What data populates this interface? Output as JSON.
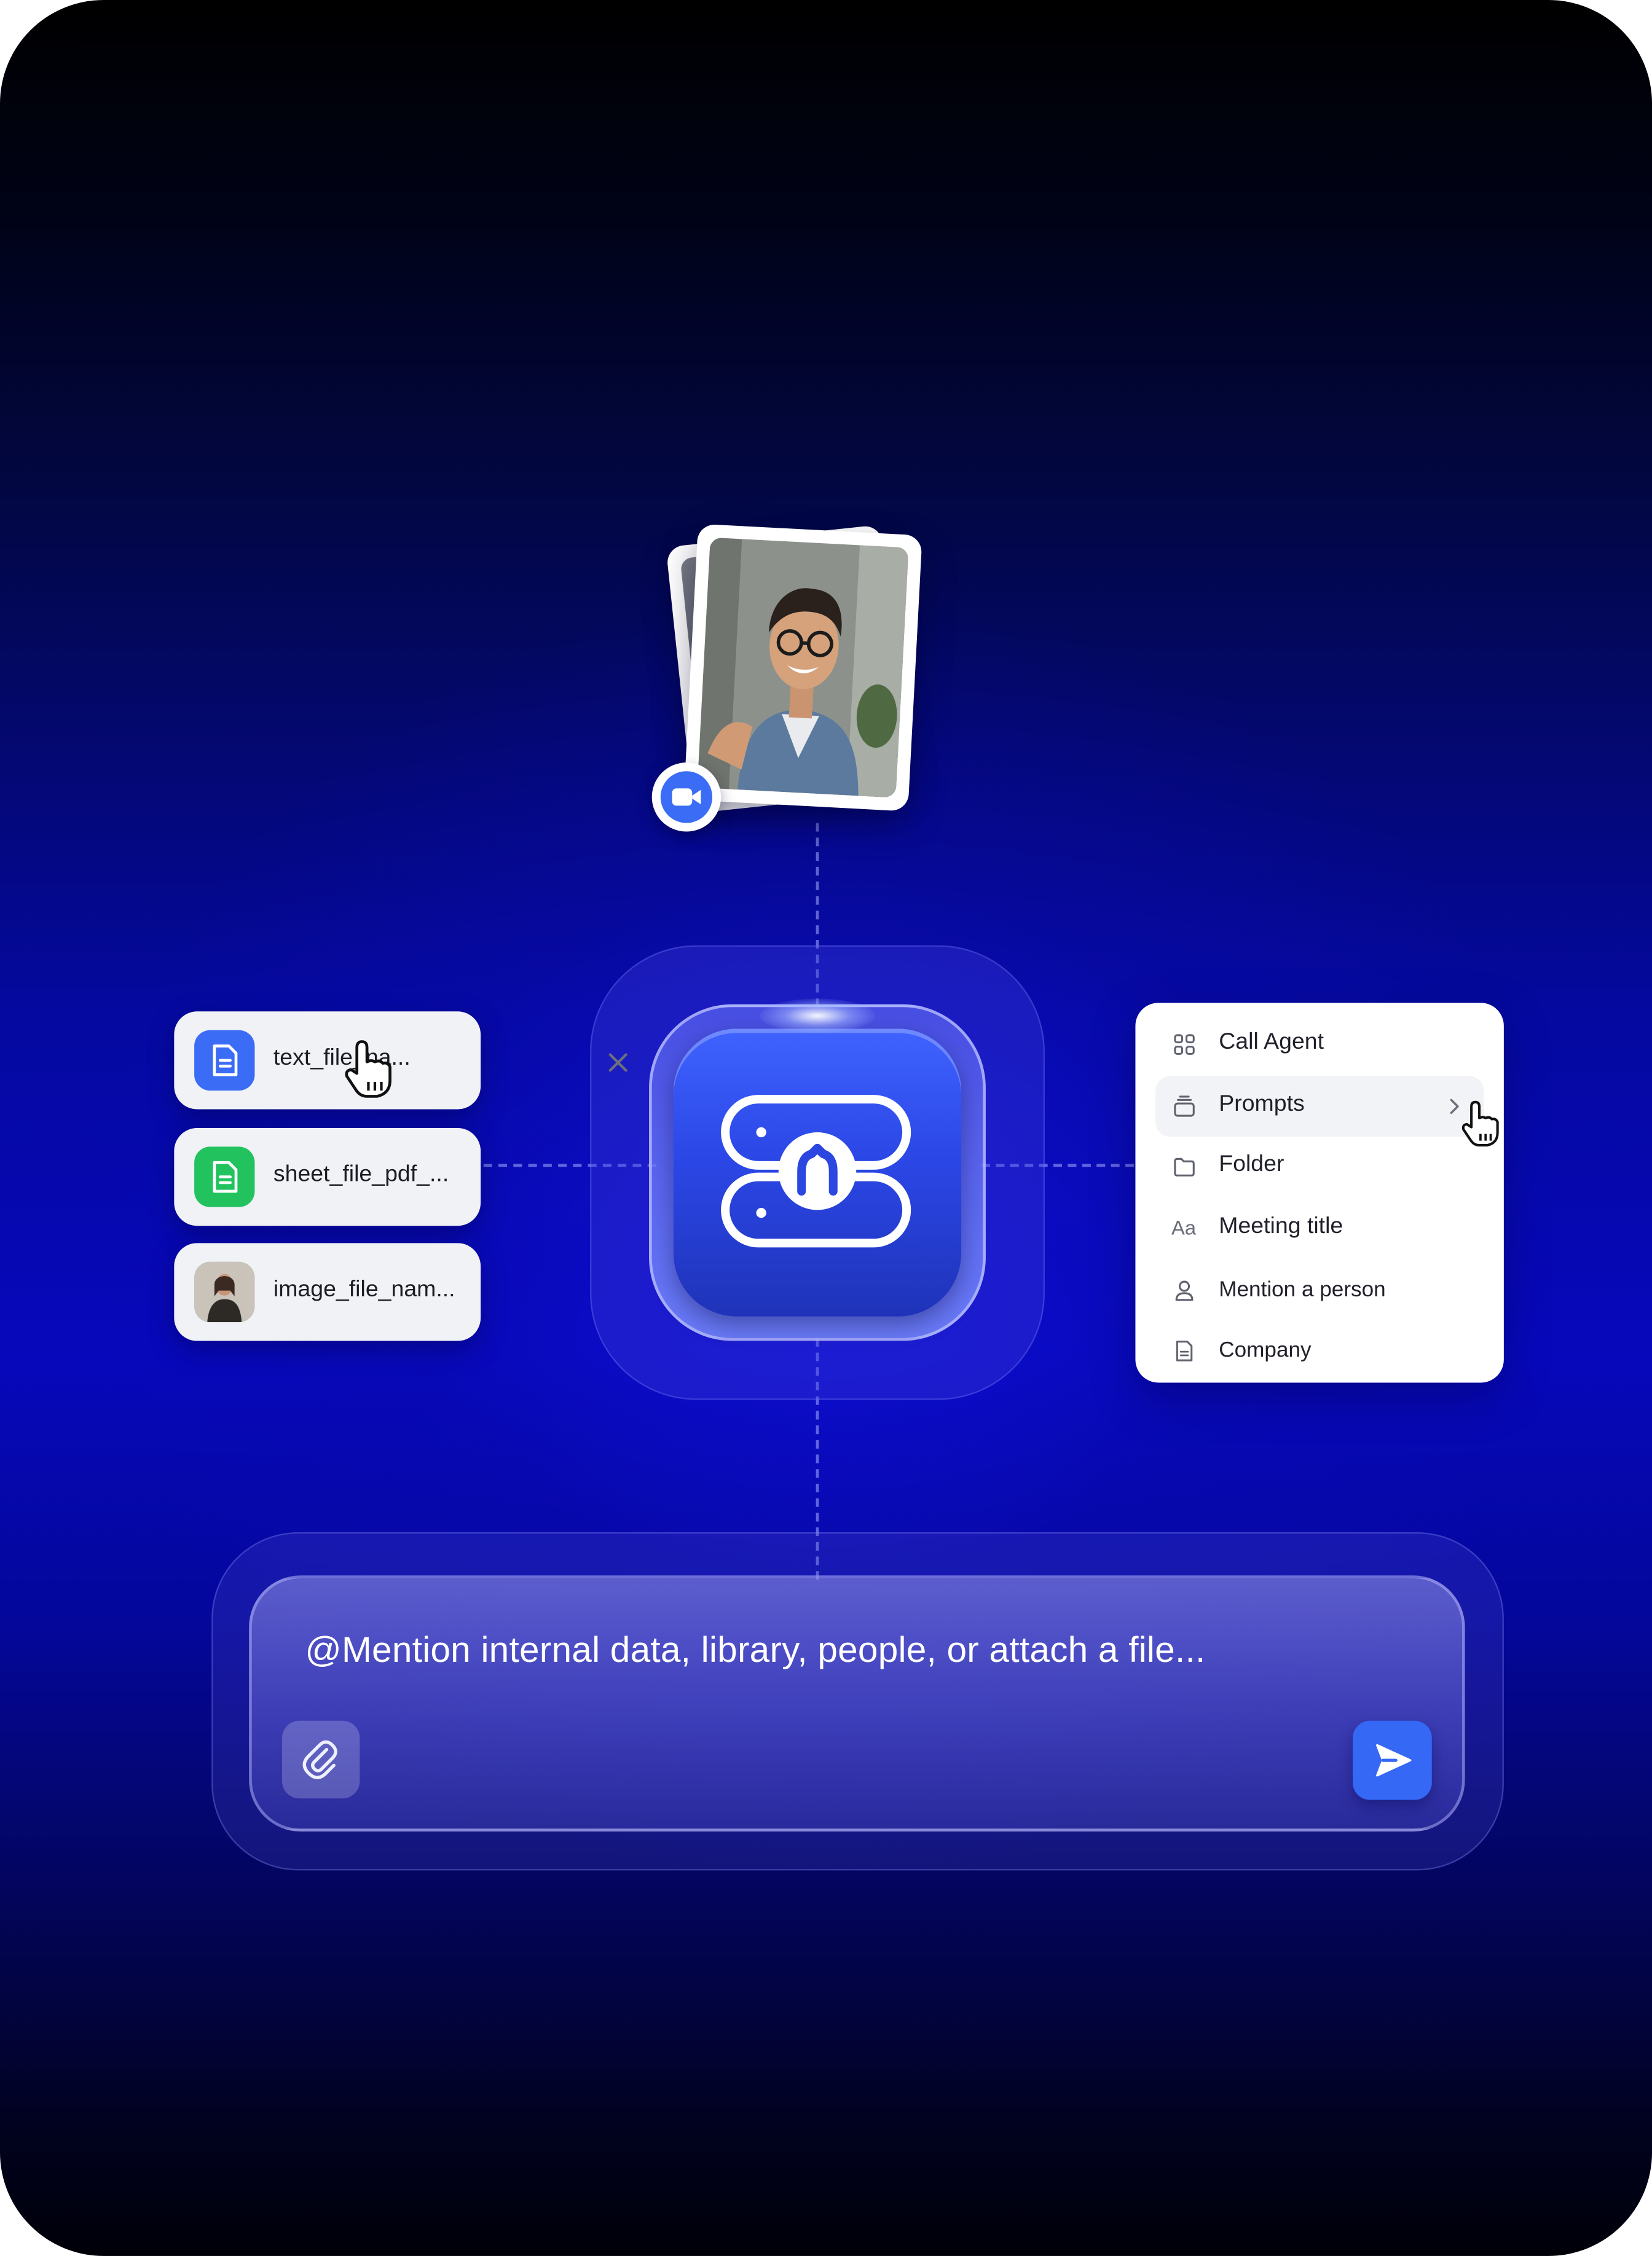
{
  "files": [
    {
      "name": "text_file_na...",
      "type": "text",
      "color": "#3b6cf6",
      "removable": true
    },
    {
      "name": "sheet_file_pdf_...",
      "type": "sheet",
      "color": "#22c35e",
      "removable": false
    },
    {
      "name": "image_file_nam...",
      "type": "image",
      "removable": false
    }
  ],
  "menu": {
    "items": [
      {
        "label": "Call Agent",
        "icon": "grid-icon"
      },
      {
        "label": "Prompts",
        "icon": "stack-icon",
        "has_submenu": true,
        "active": true
      },
      {
        "label": "Folder",
        "icon": "folder-icon"
      },
      {
        "label": "Meeting title",
        "icon": "Aa"
      },
      {
        "label": "Mention a person",
        "icon": "person-icon"
      },
      {
        "label": "Company",
        "icon": "document-icon"
      }
    ]
  },
  "composer": {
    "placeholder": "@Mention internal data, library, people, or attach a file...",
    "attach_icon": "paperclip-icon",
    "send_icon": "send-icon"
  },
  "colors": {
    "accent": "#3468f5",
    "hub": "#2b47e6",
    "background": "#0708bb"
  }
}
